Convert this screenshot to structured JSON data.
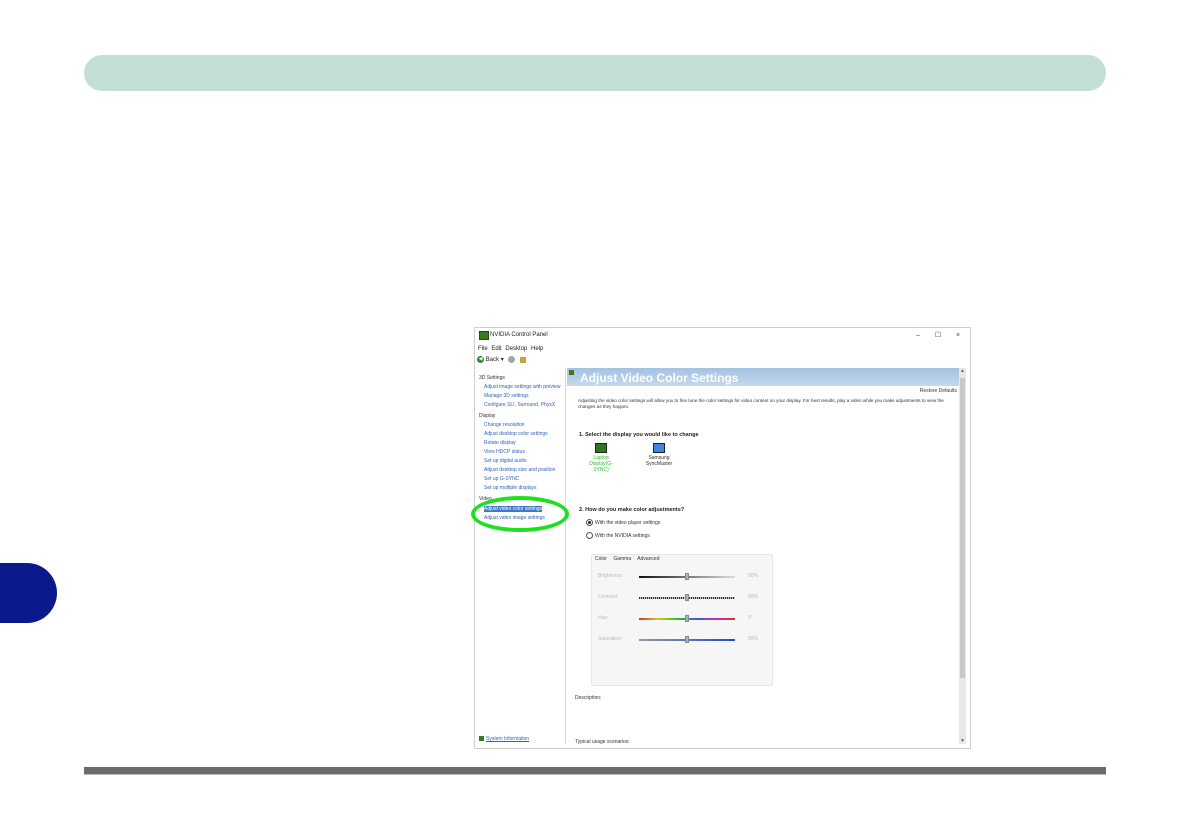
{
  "window": {
    "title": "NVIDIA Control Panel",
    "minimize": "–",
    "maximize": "☐",
    "close": "×"
  },
  "menu": [
    "File",
    "Edit",
    "Desktop",
    "Help"
  ],
  "toolbar": {
    "back_label": "Back"
  },
  "tree": {
    "cat_3d": "3D Settings",
    "items_3d": [
      "Adjust image settings with preview",
      "Manage 3D settings",
      "Configure SLI, Surround, PhysX"
    ],
    "cat_display": "Display",
    "items_display": [
      "Change resolution",
      "Adjust desktop color settings",
      "Rotate display",
      "View HDCP status",
      "Set up digital audio",
      "Adjust desktop size and position",
      "Set up G-SYNC",
      "Set up multiple displays"
    ],
    "cat_video": "Video",
    "items_video": [
      "Adjust video color settings",
      "Adjust video image settings"
    ],
    "system_info": "System Information"
  },
  "content": {
    "title": "Adjust Video Color Settings",
    "restore_defaults": "Restore Defaults",
    "description": "Adjusting the video color settings will allow you to fine tune the color settings for video content on your display. For best results, play a video while you make adjustments to view the changes as they happen.",
    "section1": "1. Select the display you would like to change",
    "displays": [
      {
        "label1": "Laptop",
        "label2": "Display(G-SYNC)"
      },
      {
        "label1": "Samsung",
        "label2": "SyncMaster"
      }
    ],
    "section2": "2. How do you make color adjustments?",
    "radio1": "With the video player settings",
    "radio2": "With the NVIDIA settings",
    "tabs": [
      "Color",
      "Gamma",
      "Advanced"
    ],
    "sliders": [
      {
        "label": "Brightness:",
        "value": "50%"
      },
      {
        "label": "Contrast:",
        "value": "50%"
      },
      {
        "label": "Hue:",
        "value": "0°"
      },
      {
        "label": "Saturation:",
        "value": "50%"
      }
    ],
    "description_label": "Description:",
    "typical_label": "Typical usage scenarios:"
  }
}
